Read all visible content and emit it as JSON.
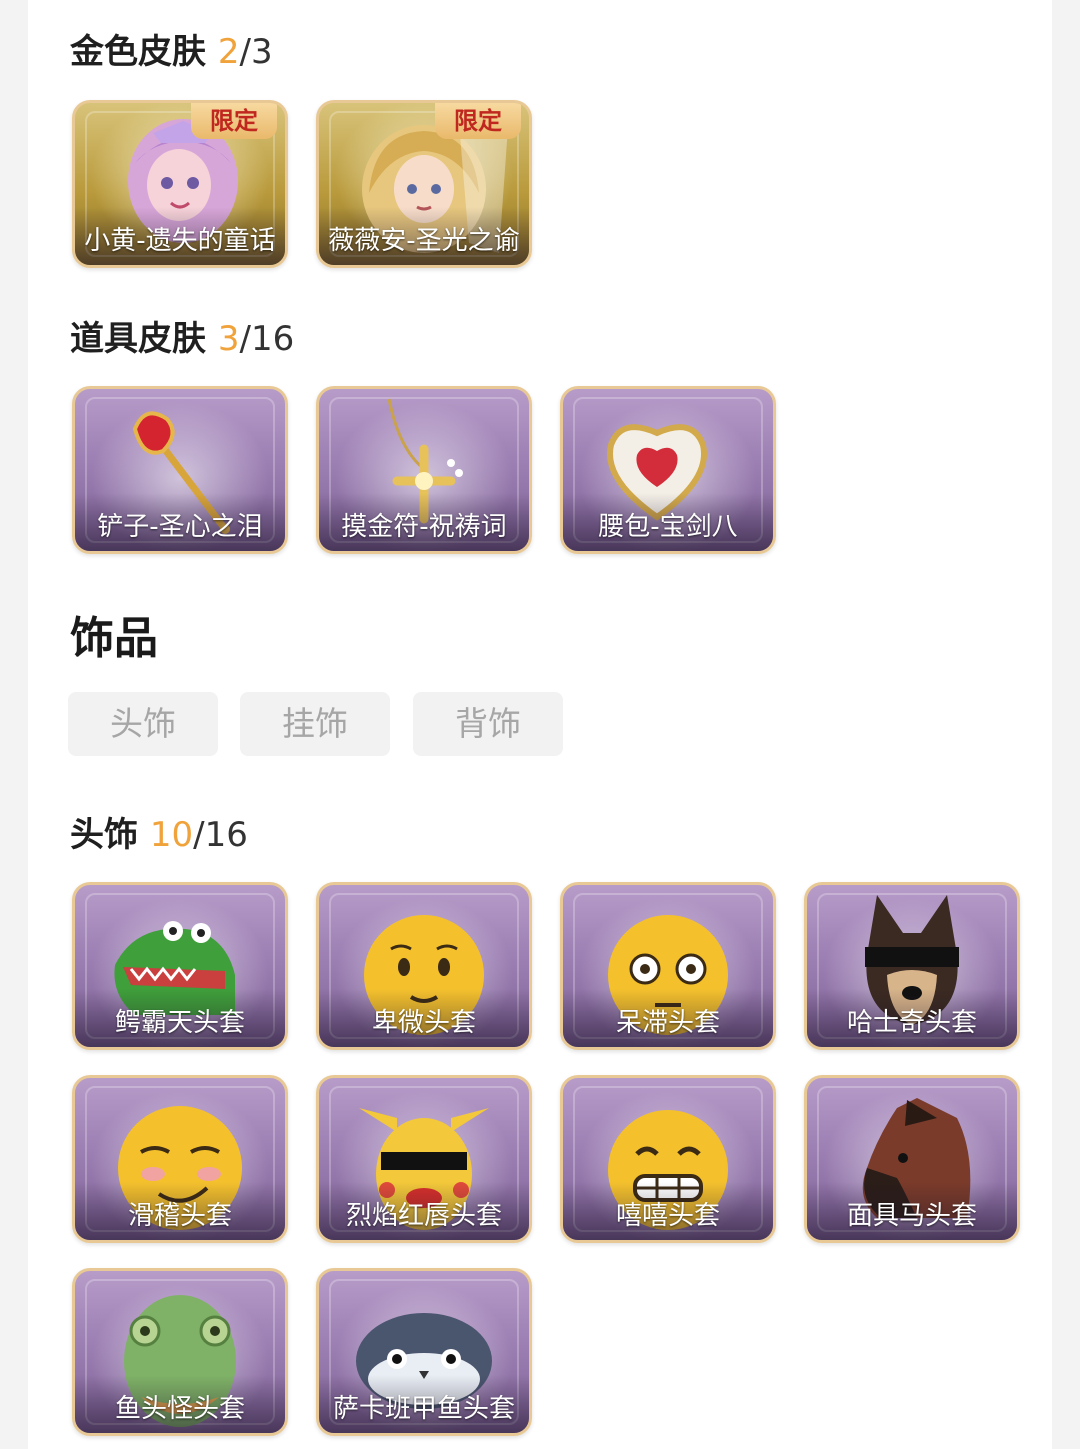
{
  "gold_skins": {
    "title": "金色皮肤",
    "owned": "2",
    "total": "/3",
    "items": [
      {
        "label": "小黄-遗失的童话",
        "badge": "限定"
      },
      {
        "label": "薇薇安-圣光之谕",
        "badge": "限定"
      }
    ]
  },
  "prop_skins": {
    "title": "道具皮肤",
    "owned": "3",
    "total": "/16",
    "items": [
      {
        "label": "铲子-圣心之泪"
      },
      {
        "label": "摸金符-祝祷词"
      },
      {
        "label": "腰包-宝剑八"
      }
    ]
  },
  "accessories": {
    "title": "饰品",
    "tabs": [
      "头饰",
      "挂饰",
      "背饰"
    ]
  },
  "headwear": {
    "title": "头饰",
    "owned": "10",
    "total": "/16",
    "items": [
      {
        "label": "鳄霸天头套"
      },
      {
        "label": "卑微头套"
      },
      {
        "label": "呆滞头套"
      },
      {
        "label": "哈士奇头套"
      },
      {
        "label": "滑稽头套"
      },
      {
        "label": "烈焰红唇头套"
      },
      {
        "label": "嘻嘻头套"
      },
      {
        "label": "面具马头套"
      },
      {
        "label": "鱼头怪头套"
      },
      {
        "label": "萨卡班甲鱼头套"
      }
    ]
  },
  "colors": {
    "accent_count": "#f0a23b",
    "card_border": "#e8c995",
    "chip_bg": "#f2f2f2"
  }
}
